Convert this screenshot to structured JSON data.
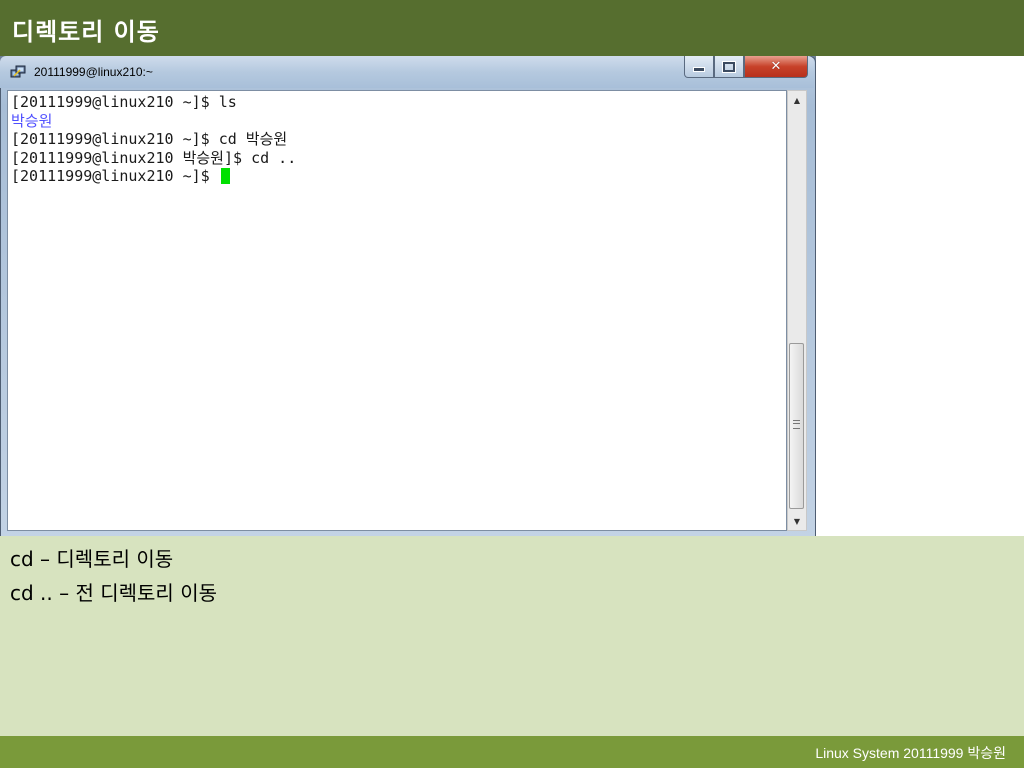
{
  "slide": {
    "title": "디렉토리 이동",
    "bullets": [
      "cd – 디렉토리 이동",
      "cd .. – 전 디렉토리 이동"
    ],
    "footer": "Linux System 20111999 박승원"
  },
  "window": {
    "title": "20111999@linux210:~",
    "icon": "putty-icon",
    "controls": {
      "minimize": "minimize-icon",
      "maximize": "maximize-icon",
      "close": "close-icon"
    }
  },
  "terminal": {
    "lines": [
      "[20111999@linux210 ~]$ ls",
      "박승원",
      "[20111999@linux210 ~]$ cd 박승원",
      "[20111999@linux210 박승원]$ cd ..",
      "[20111999@linux210 ~]$ "
    ],
    "directory_color": "#5050ff",
    "cursor_color": "#00e000"
  },
  "colors": {
    "title_bar": "#566e2f",
    "content_bg": "#d7e3bf",
    "footer_bar": "#7a9a3a"
  }
}
